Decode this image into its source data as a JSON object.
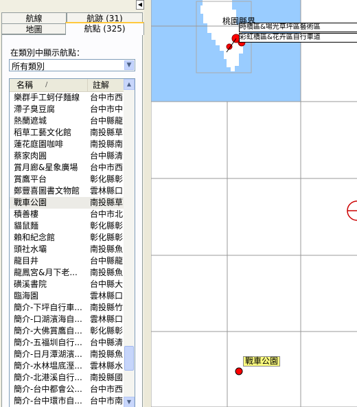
{
  "tabs": {
    "routes": "航線",
    "tracks": "航跡 (31)",
    "map": "地圖",
    "waypoints": "航點 (325)"
  },
  "filter": {
    "label": "在類別中顯示航點：",
    "selected": "所有類別"
  },
  "list": {
    "col_name": "名稱",
    "col_sort": "/",
    "col_note": "註解",
    "rows": [
      {
        "name": "樂群手工蚵仔麵線",
        "note": "台中市西"
      },
      {
        "name": "滯子臭豆腐",
        "note": "台中市中"
      },
      {
        "name": "熱蘭遮城",
        "note": "台中縣龍"
      },
      {
        "name": "稻草工藝文化館",
        "note": "南投縣草"
      },
      {
        "name": "蓮花庭園咖啡",
        "note": "南投縣南"
      },
      {
        "name": "蔡家肉圓",
        "note": "台中縣清"
      },
      {
        "name": "賞月廊&星象廣場",
        "note": "台中市西"
      },
      {
        "name": "賞鷹平台",
        "note": "彰化縣彰"
      },
      {
        "name": "鄭豐喜圖書文物館",
        "note": "雲林縣口"
      },
      {
        "name": "戰車公園",
        "note": "南投縣草"
      },
      {
        "name": "積善樓",
        "note": "台中市北"
      },
      {
        "name": "貓鼠麵",
        "note": "彰化縣彰"
      },
      {
        "name": "賴和紀念館",
        "note": "彰化縣彰"
      },
      {
        "name": "頭社水壩",
        "note": "南投縣魚"
      },
      {
        "name": "龍目井",
        "note": "台中縣龍"
      },
      {
        "name": "龍鳳宮&月下老...",
        "note": "南投縣魚"
      },
      {
        "name": "磺溪書院",
        "note": "台中縣大"
      },
      {
        "name": "臨海園",
        "note": "雲林縣口"
      },
      {
        "name": "簡介-下坪自行車...",
        "note": "南投縣竹"
      },
      {
        "name": "簡介-口湖濱海自...",
        "note": "雲林縣口"
      },
      {
        "name": "簡介-大佛賞鷹自...",
        "note": "彰化縣彰"
      },
      {
        "name": "簡介-五福圳自行...",
        "note": "台中縣清"
      },
      {
        "name": "簡介-日月潭湖濱...",
        "note": "南投縣魚"
      },
      {
        "name": "簡介-水林塭底溼...",
        "note": "雲林縣水"
      },
      {
        "name": "簡介-北港溪自行...",
        "note": "南投縣國"
      },
      {
        "name": "簡介-台中都會公...",
        "note": "台中市西"
      },
      {
        "name": "簡介-台中環市自...",
        "note": "台中市南"
      }
    ]
  },
  "map": {
    "county_label": "桃園縣界",
    "wp_label_1": "時橋區&場光草坪區藝術區",
    "wp_label_2": "彩虹橋區&花卉區自行車道",
    "selected_label": "戰車公園",
    "image_id": "#125186",
    "colors": {
      "sea": "#99ccff",
      "land": "#ffffff",
      "grid": "#999999",
      "marker": "#ff0000"
    }
  }
}
